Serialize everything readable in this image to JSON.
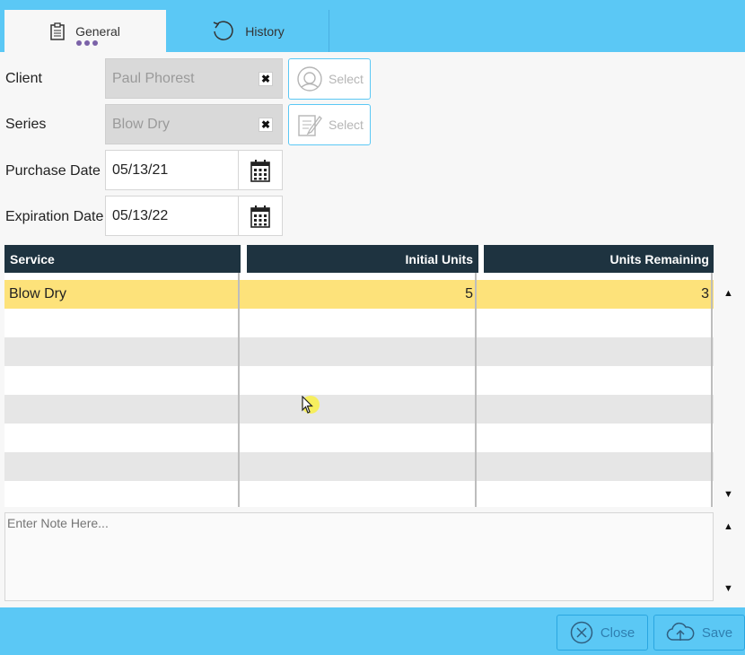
{
  "tabs": [
    {
      "label": "General",
      "icon": "clipboard-icon",
      "active": true
    },
    {
      "label": "History",
      "icon": "history-icon",
      "active": false
    }
  ],
  "form": {
    "client_label": "Client",
    "client_value": "Paul Phorest",
    "series_label": "Series",
    "series_value": "Blow Dry",
    "purchase_date_label": "Purchase Date",
    "purchase_date_value": "05/13/21",
    "expiration_date_label": "Expiration Date",
    "expiration_date_value": "05/13/22",
    "select_label": "Select",
    "clear_glyph": "✖"
  },
  "table": {
    "headers": [
      "Service",
      "Initial Units",
      "Units Remaining"
    ],
    "rows": [
      {
        "service": "Blow Dry",
        "initial_units": "5",
        "units_remaining": "3"
      }
    ]
  },
  "note": {
    "placeholder": "Enter Note Here..."
  },
  "footer": {
    "close_label": "Close",
    "save_label": "Save"
  },
  "colors": {
    "accent": "#5bc8f5",
    "header": "#1e3340",
    "selected_row": "#fde27a",
    "tab_dots": "#7b62a8"
  }
}
